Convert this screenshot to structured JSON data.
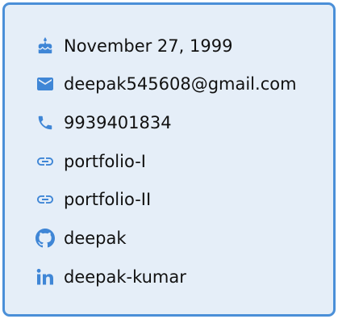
{
  "accent_color": "#3f86d6",
  "border_color": "#4a8fd8",
  "card_background": "#e5eef8",
  "items": [
    {
      "icon": "cake-icon",
      "text": "November 27, 1999"
    },
    {
      "icon": "email-icon",
      "text": "deepak545608@gmail.com"
    },
    {
      "icon": "phone-icon",
      "text": "9939401834"
    },
    {
      "icon": "link-icon",
      "text": "portfolio-I"
    },
    {
      "icon": "link-icon",
      "text": "portfolio-II"
    },
    {
      "icon": "github-icon",
      "text": "deepak"
    },
    {
      "icon": "linkedin-icon",
      "text": "deepak-kumar"
    }
  ]
}
